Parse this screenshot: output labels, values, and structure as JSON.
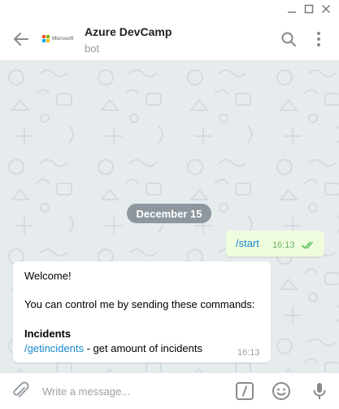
{
  "window": {
    "controls": [
      "minimize-icon",
      "maximize-icon",
      "close-icon"
    ]
  },
  "header": {
    "title": "Azure DevCamp",
    "subtitle": "bot",
    "avatar_text": "Microsoft",
    "icons": [
      "back-arrow-icon",
      "search-icon",
      "more-vertical-icon"
    ]
  },
  "chat": {
    "date_separator": "December 15",
    "outgoing": {
      "text": "/start",
      "time": "16:13",
      "status_icon": "double-check-icon"
    },
    "incoming": {
      "line1": "Welcome!",
      "line2": "You can control me by sending these commands:",
      "section_title": "Incidents",
      "command": "/getincidents",
      "command_desc": " - get amount of incidents",
      "time": "16:13"
    }
  },
  "input": {
    "placeholder": "Write a message...",
    "icons": [
      "attach-icon",
      "bot-command-icon",
      "emoji-icon",
      "microphone-icon"
    ]
  },
  "colors": {
    "accent": "#168acd",
    "chat_bg": "#e6ebee",
    "outgoing_bubble": "#effdde",
    "date_pill": "#8e979e",
    "ms_logo": [
      "#f25022",
      "#7fba00",
      "#00a4ef",
      "#ffb900"
    ]
  }
}
